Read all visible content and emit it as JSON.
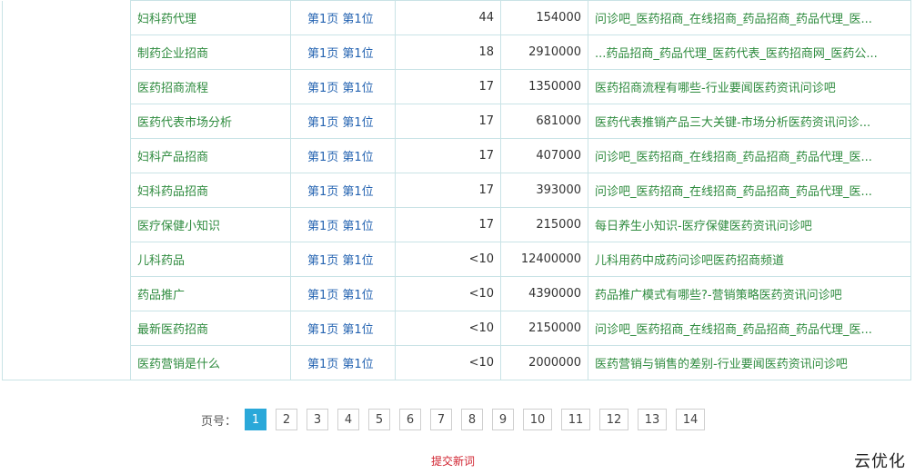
{
  "table": {
    "rows": [
      {
        "keyword": "妇科药代理",
        "rank": "第1页 第1位",
        "index": "44",
        "volume": "154000",
        "title": "问诊吧_医药招商_在线招商_药品招商_药品代理_医..."
      },
      {
        "keyword": "制药企业招商",
        "rank": "第1页 第1位",
        "index": "18",
        "volume": "2910000",
        "title": "...药品招商_药品代理_医药代表_医药招商网_医药公..."
      },
      {
        "keyword": "医药招商流程",
        "rank": "第1页 第1位",
        "index": "17",
        "volume": "1350000",
        "title": "医药招商流程有哪些-行业要闻医药资讯问诊吧"
      },
      {
        "keyword": "医药代表市场分析",
        "rank": "第1页 第1位",
        "index": "17",
        "volume": "681000",
        "title": "医药代表推销产品三大关键-市场分析医药资讯问诊..."
      },
      {
        "keyword": "妇科产品招商",
        "rank": "第1页 第1位",
        "index": "17",
        "volume": "407000",
        "title": "问诊吧_医药招商_在线招商_药品招商_药品代理_医..."
      },
      {
        "keyword": "妇科药品招商",
        "rank": "第1页 第1位",
        "index": "17",
        "volume": "393000",
        "title": "问诊吧_医药招商_在线招商_药品招商_药品代理_医..."
      },
      {
        "keyword": "医疗保健小知识",
        "rank": "第1页 第1位",
        "index": "17",
        "volume": "215000",
        "title": "每日养生小知识-医疗保健医药资讯问诊吧"
      },
      {
        "keyword": "儿科药品",
        "rank": "第1页 第1位",
        "index": "<10",
        "volume": "12400000",
        "title": "儿科用药中成药问诊吧医药招商频道"
      },
      {
        "keyword": "药品推广",
        "rank": "第1页 第1位",
        "index": "<10",
        "volume": "4390000",
        "title": "药品推广模式有哪些?-营销策略医药资讯问诊吧"
      },
      {
        "keyword": "最新医药招商",
        "rank": "第1页 第1位",
        "index": "<10",
        "volume": "2150000",
        "title": "问诊吧_医药招商_在线招商_药品招商_药品代理_医..."
      },
      {
        "keyword": "医药营销是什么",
        "rank": "第1页 第1位",
        "index": "<10",
        "volume": "2000000",
        "title": "医药营销与销售的差别-行业要闻医药资讯问诊吧"
      }
    ]
  },
  "pagination": {
    "label": "页号：",
    "pages": [
      "1",
      "2",
      "3",
      "4",
      "5",
      "6",
      "7",
      "8",
      "9",
      "10",
      "11",
      "12",
      "13",
      "14"
    ],
    "current": "1"
  },
  "footer": {
    "submit_label": "提交新词",
    "logo_text": "云优化"
  },
  "colors": {
    "accent": "#2aa8d9",
    "keyword": "#2e8b3e",
    "rank": "#2463b1",
    "submit": "#d0202d",
    "border": "#c9e3e6"
  }
}
